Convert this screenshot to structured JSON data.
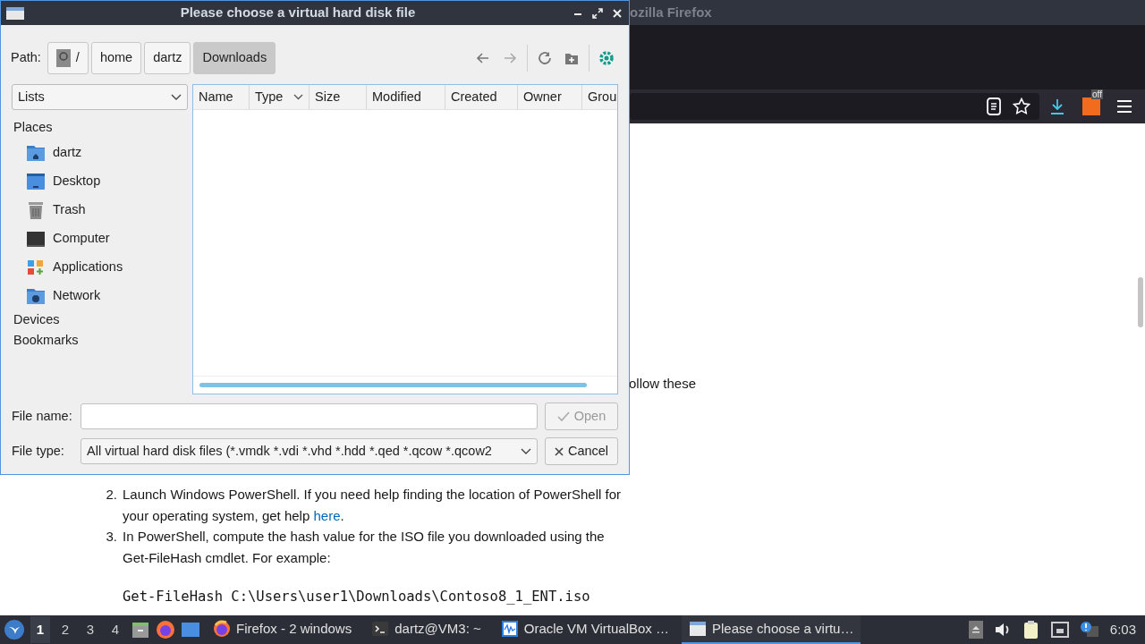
{
  "browser": {
    "title": "ozilla Firefox",
    "content": {
      "partial_line": "ollow these",
      "steps": [
        {
          "number": "2.",
          "text": "Launch Windows PowerShell. If you need help finding the location of PowerShell for your operating system, get help ",
          "link": "here",
          "after": "."
        },
        {
          "number": "3.",
          "text": "In PowerShell, compute the hash value for the ISO file you downloaded using the Get-FileHash cmdlet. For example:"
        }
      ],
      "code": "Get-FileHash C:\\Users\\user1\\Downloads\\Contoso8_1_ENT.iso"
    },
    "extension_badge": "off"
  },
  "dialog": {
    "title": "Please choose a virtual hard disk file",
    "path_label": "Path:",
    "crumbs": [
      {
        "label": "/",
        "kind": "root",
        "selected": false
      },
      {
        "label": "home",
        "kind": "dir",
        "selected": false
      },
      {
        "label": "dartz",
        "kind": "dir",
        "selected": false
      },
      {
        "label": "Downloads",
        "kind": "dir",
        "selected": true
      }
    ],
    "view_select": "Lists",
    "places_heading": "Places",
    "places": [
      {
        "label": "dartz",
        "kind": "home"
      },
      {
        "label": "Desktop",
        "kind": "desktop"
      },
      {
        "label": "Trash",
        "kind": "trash"
      },
      {
        "label": "Computer",
        "kind": "computer"
      },
      {
        "label": "Applications",
        "kind": "apps"
      },
      {
        "label": "Network",
        "kind": "network"
      }
    ],
    "sections": [
      "Devices",
      "Bookmarks"
    ],
    "columns": [
      {
        "label": "Name",
        "dropdown": false
      },
      {
        "label": "Type",
        "dropdown": true
      },
      {
        "label": "Size",
        "dropdown": false
      },
      {
        "label": "Modified",
        "dropdown": false
      },
      {
        "label": "Created",
        "dropdown": false
      },
      {
        "label": "Owner",
        "dropdown": false
      },
      {
        "label": "Grou"
      }
    ],
    "file_name_label": "File name:",
    "file_type_label": "File type:",
    "file_type": "All virtual hard disk files (*.vmdk *.vdi *.vhd *.hdd *.qed *.qcow *.qcow2",
    "open_button": {
      "label": "Open",
      "disabled": true
    },
    "cancel_button": {
      "label": "Cancel"
    }
  },
  "taskbar": {
    "workspaces": [
      {
        "label": "1",
        "selected": true
      },
      {
        "label": "2",
        "selected": false
      },
      {
        "label": "3",
        "selected": false
      },
      {
        "label": "4",
        "selected": false
      }
    ],
    "tasks": [
      {
        "label": "Firefox - 2 windows",
        "kind": "firefox",
        "selected": false
      },
      {
        "label": "dartz@VM3: ~",
        "kind": "terminal",
        "selected": false
      },
      {
        "label": "Oracle VM VirtualBox …",
        "kind": "virtualbox",
        "selected": false
      },
      {
        "label": "Please choose a virtu…",
        "kind": "dialog",
        "selected": true
      }
    ],
    "clock": "6:03"
  }
}
